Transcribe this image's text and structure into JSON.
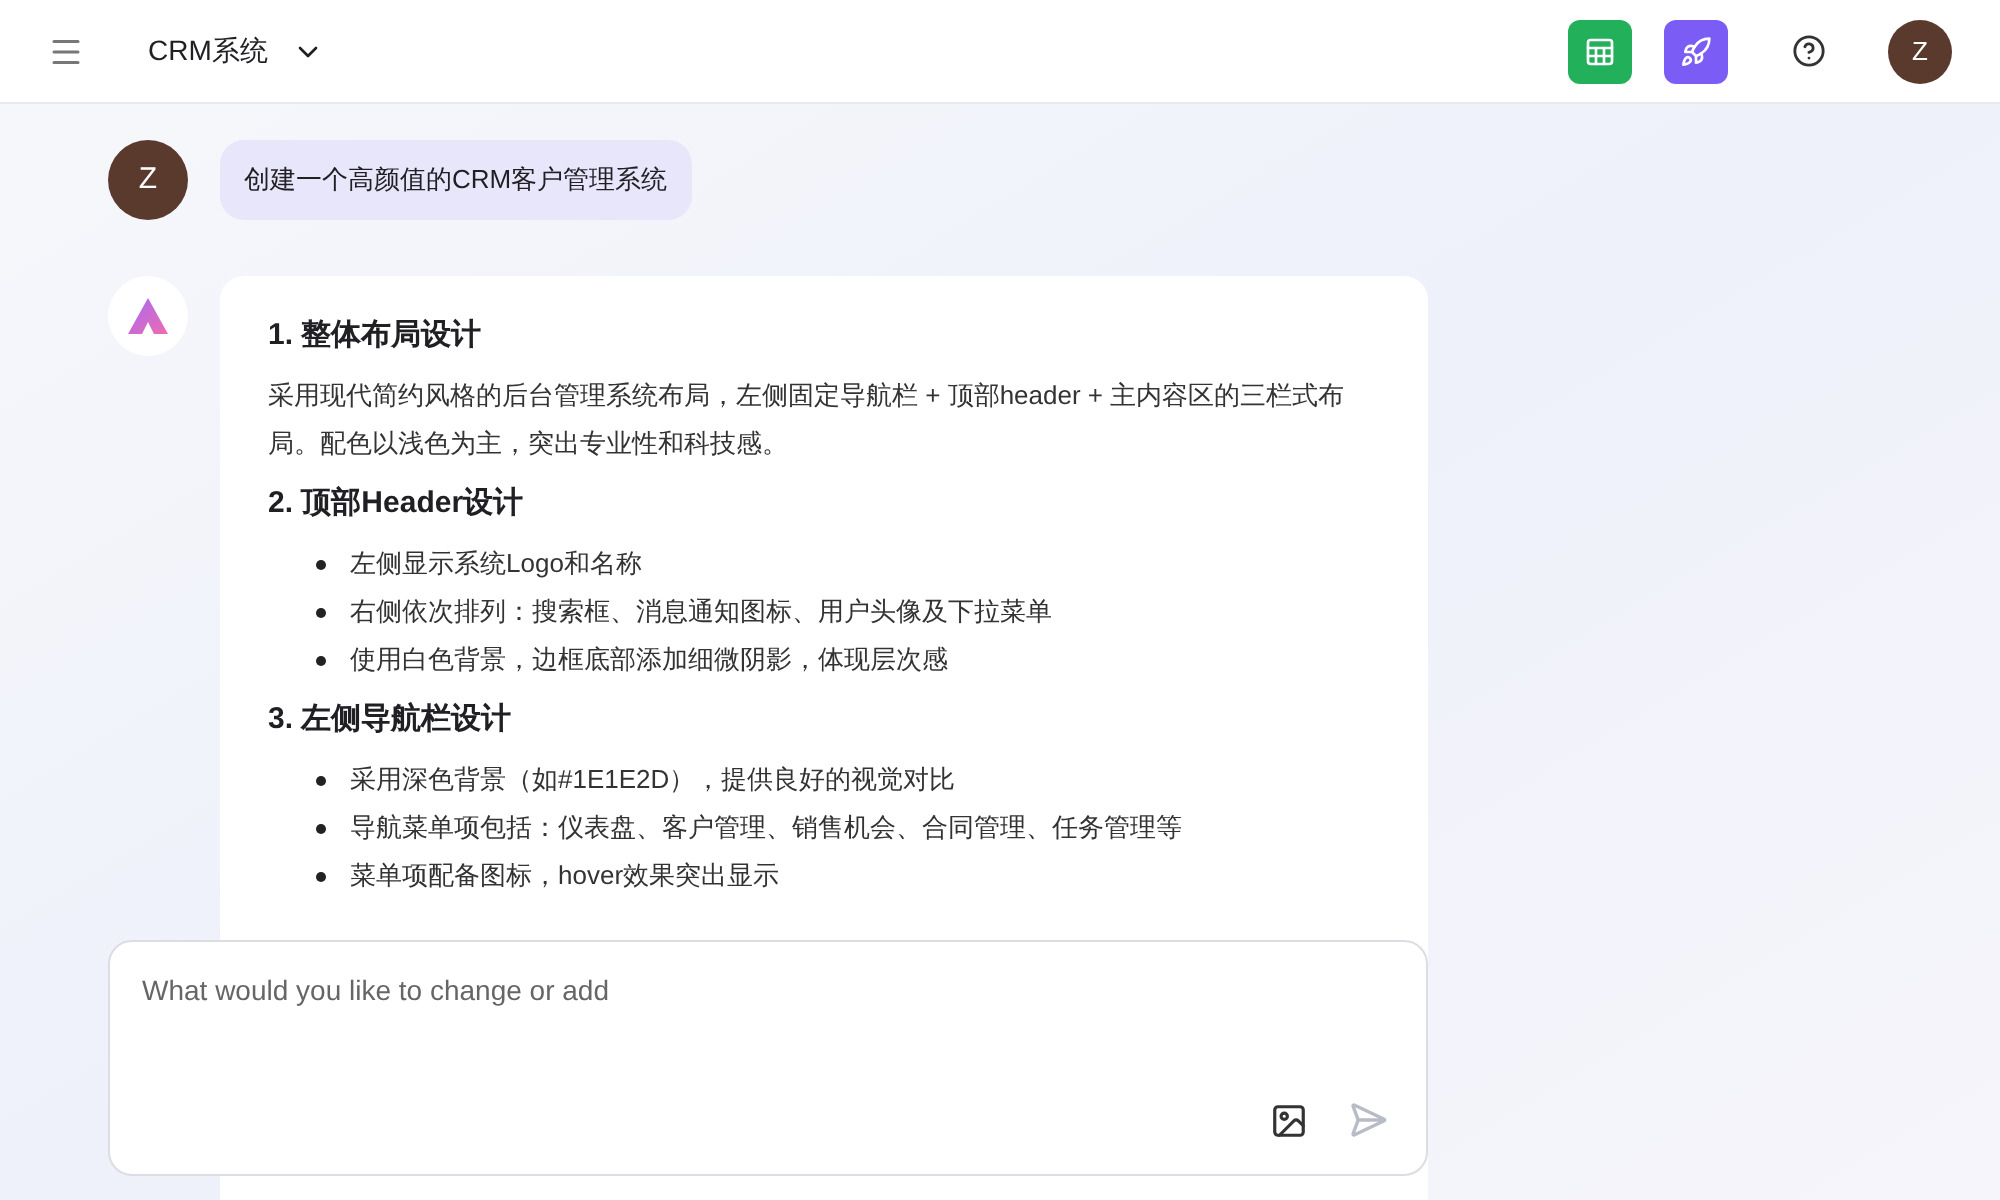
{
  "header": {
    "project": "CRM系统",
    "avatar": "Z"
  },
  "user_message": {
    "avatar": "Z",
    "text": "创建一个高颜值的CRM客户管理系统"
  },
  "reply": {
    "sections": [
      {
        "heading": "1. 整体布局设计",
        "paragraph": "采用现代简约风格的后台管理系统布局，左侧固定导航栏 + 顶部header + 主内容区的三栏式布局。配色以浅色为主，突出专业性和科技感。"
      },
      {
        "heading": "2. 顶部Header设计",
        "bullets": [
          "左侧显示系统Logo和名称",
          "右侧依次排列：搜索框、消息通知图标、用户头像及下拉菜单",
          "使用白色背景，边框底部添加细微阴影，体现层次感"
        ]
      },
      {
        "heading": "3. 左侧导航栏设计",
        "bullets": [
          "采用深色背景（如#1E1E2D），提供良好的视觉对比",
          "导航菜单项包括：仪表盘、客户管理、销售机会、合同管理、任务管理等",
          "菜单项配备图标，hover效果突出显示"
        ]
      }
    ]
  },
  "composer": {
    "placeholder": "What would you like to change or add"
  }
}
